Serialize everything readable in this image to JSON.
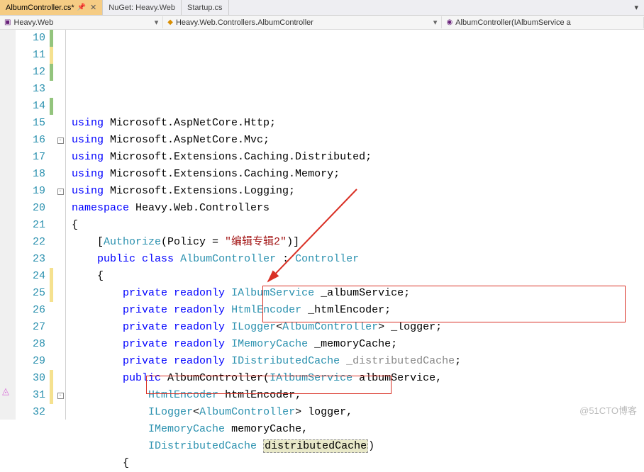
{
  "tabs": [
    {
      "label": "AlbumController.cs*",
      "active": true,
      "pinned": true
    },
    {
      "label": "NuGet: Heavy.Web",
      "active": false
    },
    {
      "label": "Startup.cs",
      "active": false
    }
  ],
  "nav": {
    "left": "Heavy.Web",
    "middle": "Heavy.Web.Controllers.AlbumController",
    "right": "AlbumController(IAlbumService a"
  },
  "lines": [
    {
      "n": 10,
      "marker": "green",
      "tokens": [
        [
          "kw",
          "using"
        ],
        [
          "",
          " Microsoft.AspNetCore.Http;"
        ]
      ]
    },
    {
      "n": 11,
      "marker": "yellow",
      "tokens": [
        [
          "kw",
          "using"
        ],
        [
          "",
          " Microsoft.AspNetCore.Mvc;"
        ]
      ]
    },
    {
      "n": 12,
      "marker": "green",
      "tokens": [
        [
          "kw",
          "using"
        ],
        [
          "",
          " Microsoft.Extensions.Caching.Distributed;"
        ]
      ]
    },
    {
      "n": 13,
      "marker": "",
      "tokens": [
        [
          "kw",
          "using"
        ],
        [
          "",
          " Microsoft.Extensions.Caching.Memory;"
        ]
      ]
    },
    {
      "n": 14,
      "marker": "green",
      "tokens": [
        [
          "kw",
          "using"
        ],
        [
          "",
          " Microsoft.Extensions.Logging;"
        ]
      ]
    },
    {
      "n": 15,
      "marker": "",
      "tokens": [
        [
          "",
          ""
        ]
      ]
    },
    {
      "n": 16,
      "marker": "",
      "fold": "-",
      "tokens": [
        [
          "kw",
          "namespace"
        ],
        [
          "",
          " Heavy.Web.Controllers"
        ]
      ]
    },
    {
      "n": 17,
      "marker": "",
      "tokens": [
        [
          "",
          "{"
        ]
      ]
    },
    {
      "n": 18,
      "marker": "",
      "tokens": [
        [
          "",
          "    ["
        ],
        [
          "type",
          "Authorize"
        ],
        [
          "",
          "(Policy = "
        ],
        [
          "str",
          "\"编辑专辑2\""
        ],
        [
          "",
          ")]"
        ]
      ]
    },
    {
      "n": 19,
      "marker": "",
      "fold": "-",
      "tokens": [
        [
          "",
          "    "
        ],
        [
          "kw",
          "public"
        ],
        [
          "",
          " "
        ],
        [
          "kw",
          "class"
        ],
        [
          "",
          " "
        ],
        [
          "type",
          "AlbumController"
        ],
        [
          "",
          " : "
        ],
        [
          "type",
          "Controller"
        ]
      ]
    },
    {
      "n": 20,
      "marker": "",
      "tokens": [
        [
          "",
          "    {"
        ]
      ]
    },
    {
      "n": 21,
      "marker": "",
      "tokens": [
        [
          "",
          "        "
        ],
        [
          "kw",
          "private"
        ],
        [
          "",
          " "
        ],
        [
          "kw",
          "readonly"
        ],
        [
          "",
          " "
        ],
        [
          "type",
          "IAlbumService"
        ],
        [
          "",
          " _albumService;"
        ]
      ]
    },
    {
      "n": 22,
      "marker": "",
      "tokens": [
        [
          "",
          "        "
        ],
        [
          "kw",
          "private"
        ],
        [
          "",
          " "
        ],
        [
          "kw",
          "readonly"
        ],
        [
          "",
          " "
        ],
        [
          "type",
          "HtmlEncoder"
        ],
        [
          "",
          " _htmlEncoder;"
        ]
      ]
    },
    {
      "n": 23,
      "marker": "",
      "tokens": [
        [
          "",
          "        "
        ],
        [
          "kw",
          "private"
        ],
        [
          "",
          " "
        ],
        [
          "kw",
          "readonly"
        ],
        [
          "",
          " "
        ],
        [
          "type",
          "ILogger"
        ],
        [
          "",
          "<"
        ],
        [
          "type",
          "AlbumController"
        ],
        [
          "",
          "> _logger;"
        ]
      ]
    },
    {
      "n": 24,
      "marker": "yellow",
      "tokens": [
        [
          "",
          "        "
        ],
        [
          "kw",
          "private"
        ],
        [
          "",
          " "
        ],
        [
          "kw",
          "readonly"
        ],
        [
          "",
          " "
        ],
        [
          "type",
          "IMemoryCache"
        ],
        [
          "",
          " _memoryCache;"
        ]
      ]
    },
    {
      "n": 25,
      "marker": "yellow",
      "tokens": [
        [
          "",
          "        "
        ],
        [
          "kw",
          "private"
        ],
        [
          "",
          " "
        ],
        [
          "kw",
          "readonly"
        ],
        [
          "",
          " "
        ],
        [
          "type",
          "IDistributedCache"
        ],
        [
          "",
          " "
        ],
        [
          "fade",
          "_distributedCache"
        ],
        [
          "",
          ";"
        ]
      ]
    },
    {
      "n": 26,
      "marker": "",
      "tokens": [
        [
          "",
          ""
        ]
      ]
    },
    {
      "n": 27,
      "marker": "",
      "tokens": [
        [
          "",
          "        "
        ],
        [
          "kw",
          "public"
        ],
        [
          "",
          " AlbumController("
        ],
        [
          "type",
          "IAlbumService"
        ],
        [
          "",
          " albumService,"
        ]
      ]
    },
    {
      "n": 28,
      "marker": "",
      "tokens": [
        [
          "",
          "            "
        ],
        [
          "type",
          "HtmlEncoder"
        ],
        [
          "",
          " htmlEncoder,"
        ]
      ]
    },
    {
      "n": 29,
      "marker": "",
      "tokens": [
        [
          "",
          "            "
        ],
        [
          "type",
          "ILogger"
        ],
        [
          "",
          "<"
        ],
        [
          "type",
          "AlbumController"
        ],
        [
          "",
          "> logger,"
        ]
      ]
    },
    {
      "n": 30,
      "marker": "yellow",
      "tokens": [
        [
          "",
          "            "
        ],
        [
          "type",
          "IMemoryCache"
        ],
        [
          "",
          " memoryCache,"
        ]
      ]
    },
    {
      "n": 31,
      "marker": "yellow",
      "fold": "-",
      "tokens": [
        [
          "",
          "            "
        ],
        [
          "type",
          "IDistributedCache"
        ],
        [
          "",
          " "
        ],
        [
          "hl",
          "distributedCache"
        ],
        [
          "",
          ")"
        ]
      ]
    },
    {
      "n": 32,
      "marker": "",
      "tokens": [
        [
          "",
          "        {"
        ]
      ]
    }
  ],
  "watermark": "@51CTO博客"
}
